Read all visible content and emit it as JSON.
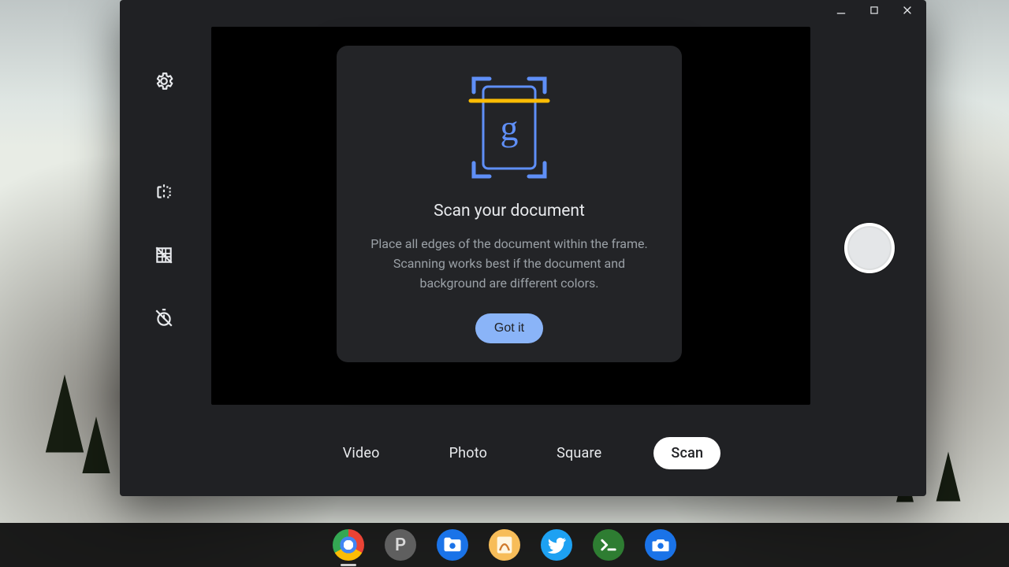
{
  "window": {
    "controls": {
      "minimize": "_",
      "maximize": "□",
      "close": "×"
    }
  },
  "sidebar": {
    "settings": "Settings",
    "mirror": "Mirroring",
    "grid": "Grid",
    "timer": "Timer"
  },
  "modes": {
    "items": [
      "Video",
      "Photo",
      "Square",
      "Scan"
    ],
    "active_index": 3
  },
  "shutter": {
    "label": "Take photo"
  },
  "card": {
    "title": "Scan your document",
    "body": "Place all edges of the document within the frame. Scanning works best if the document and background are different colors.",
    "cta": "Got it",
    "glyph": "g"
  },
  "shelf": {
    "apps": [
      {
        "id": "chrome",
        "name": "Google Chrome",
        "running": true
      },
      {
        "id": "p",
        "name": "P",
        "running": false,
        "letter": "P"
      },
      {
        "id": "files",
        "name": "Files",
        "running": false
      },
      {
        "id": "notes",
        "name": "Cursive",
        "running": false
      },
      {
        "id": "twitter",
        "name": "Twitter",
        "running": false
      },
      {
        "id": "terminal",
        "name": "Terminal",
        "running": false
      },
      {
        "id": "camera",
        "name": "Camera",
        "running": false
      }
    ]
  },
  "colors": {
    "accent": "#8ab4f8",
    "scan_line": "#fbbc04",
    "frame": "#5f8ff7"
  }
}
